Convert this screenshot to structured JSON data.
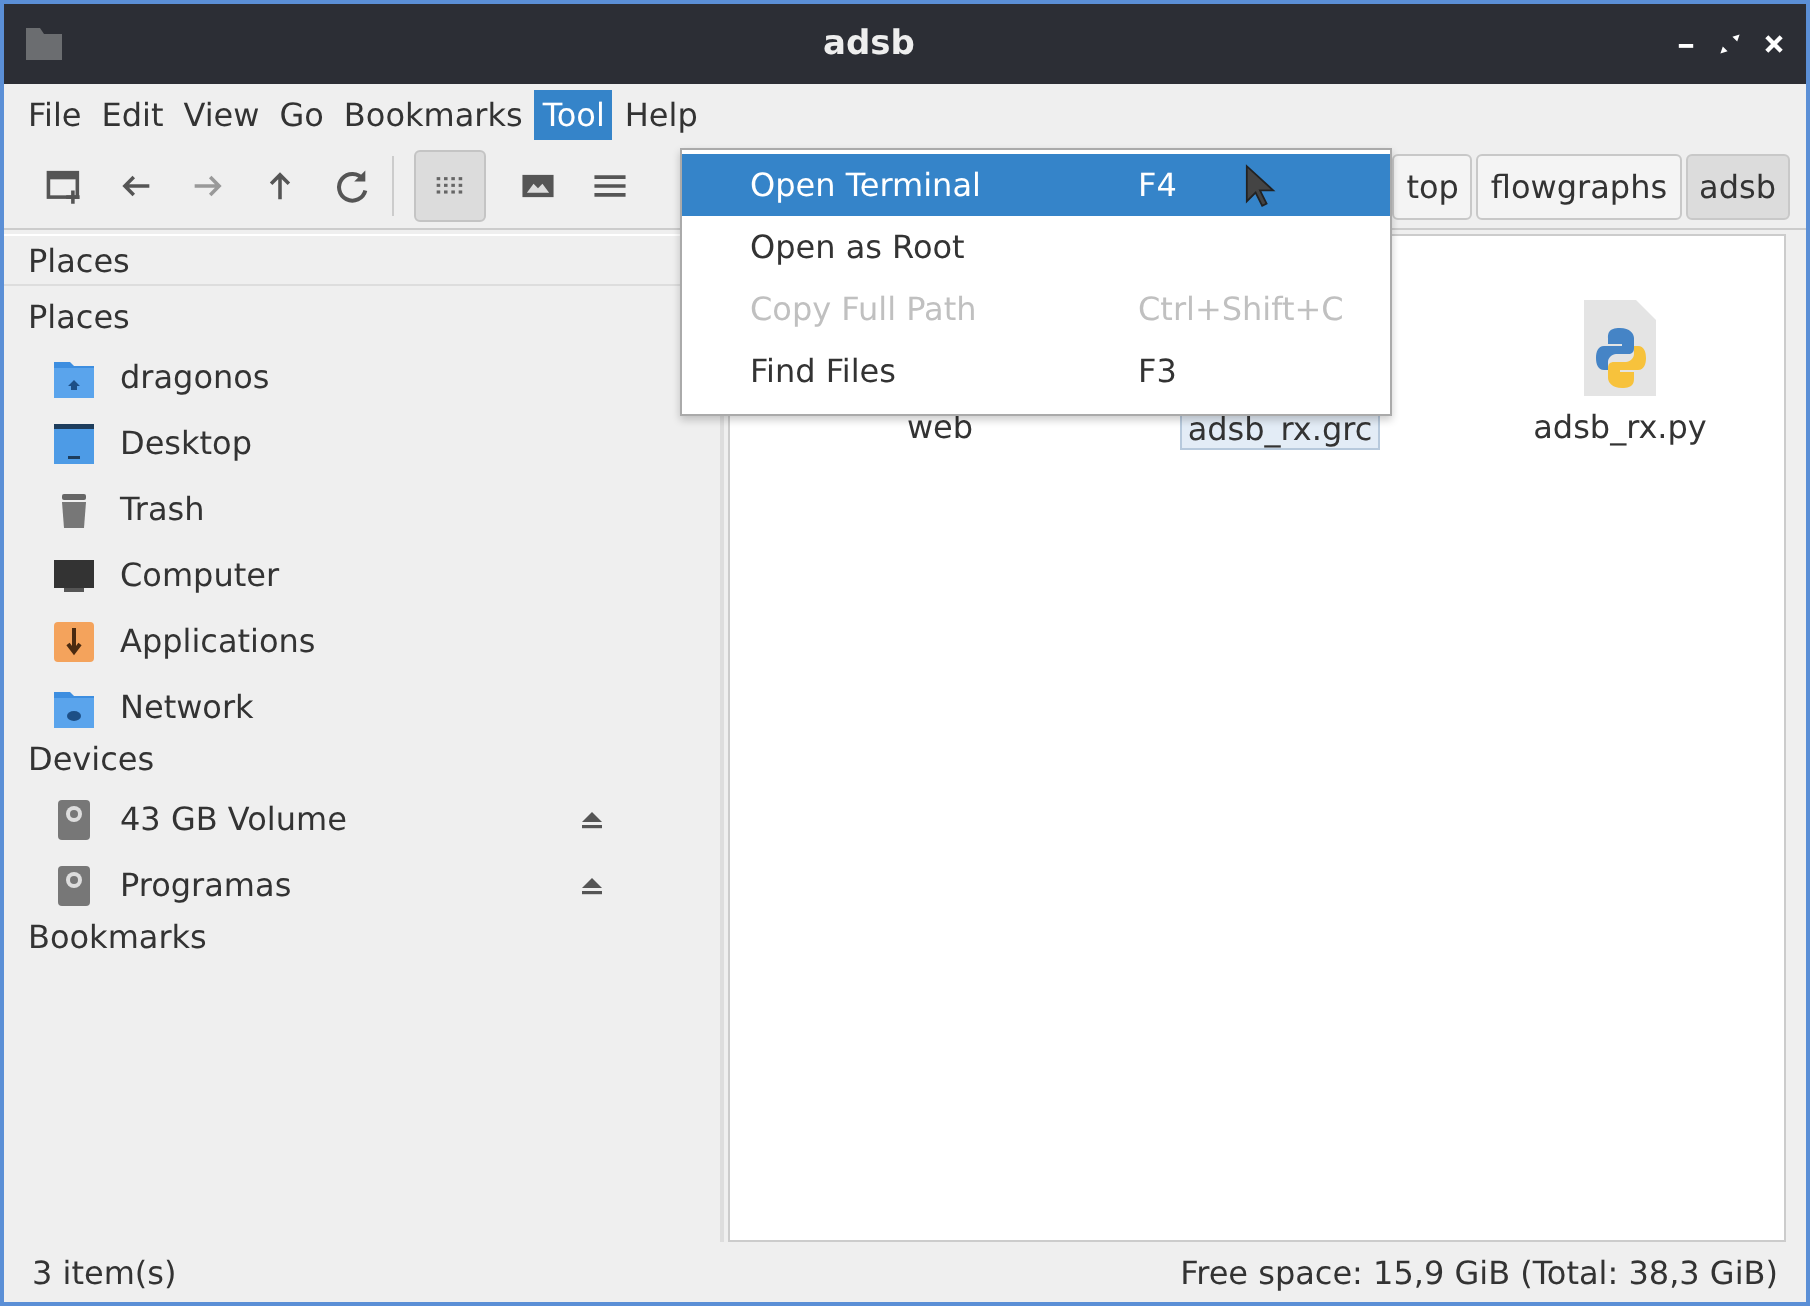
{
  "window": {
    "title": "adsb"
  },
  "menubar": [
    {
      "label": "File",
      "selected": false
    },
    {
      "label": "Edit",
      "selected": false
    },
    {
      "label": "View",
      "selected": false
    },
    {
      "label": "Go",
      "selected": false
    },
    {
      "label": "Bookmarks",
      "selected": false
    },
    {
      "label": "Tool",
      "selected": true
    },
    {
      "label": "Help",
      "selected": false
    }
  ],
  "tool_menu": [
    {
      "label": "Open Terminal",
      "shortcut": "F4",
      "selected": true,
      "disabled": false
    },
    {
      "label": "Open as Root",
      "selected": false,
      "disabled": false
    },
    {
      "label": "Copy Full Path",
      "shortcut": "Ctrl+Shift+C",
      "selected": false,
      "disabled": true
    },
    {
      "label": "Find Files",
      "shortcut": "F3",
      "selected": false,
      "disabled": false
    }
  ],
  "path_bar": [
    {
      "label": "top",
      "selected": false
    },
    {
      "label": "flowgraphs",
      "selected": false
    },
    {
      "label": "adsb",
      "selected": true
    }
  ],
  "side_pane": {
    "header": "Places",
    "sections": [
      {
        "label": "Places",
        "children": [
          {
            "label": "dragonos",
            "ejectable": false
          },
          {
            "label": "Desktop",
            "ejectable": false
          },
          {
            "label": "Trash",
            "ejectable": false
          },
          {
            "label": "Computer",
            "ejectable": false
          },
          {
            "label": "Applications",
            "ejectable": false
          },
          {
            "label": "Network",
            "ejectable": false
          }
        ]
      },
      {
        "label": "Devices",
        "children": [
          {
            "label": "43 GB Volume",
            "ejectable": true
          },
          {
            "label": "Programas",
            "ejectable": true
          }
        ]
      },
      {
        "label": "Bookmarks"
      }
    ]
  },
  "files": [
    {
      "name": "web",
      "selected": false
    },
    {
      "name": "adsb_rx.grc",
      "selected": true
    },
    {
      "name": "adsb_rx.py",
      "selected": false
    }
  ],
  "status_bar": {
    "items": "3 item(s)",
    "free_space": "Free space: 15,9 GiB (Total: 38,3 GiB)"
  }
}
